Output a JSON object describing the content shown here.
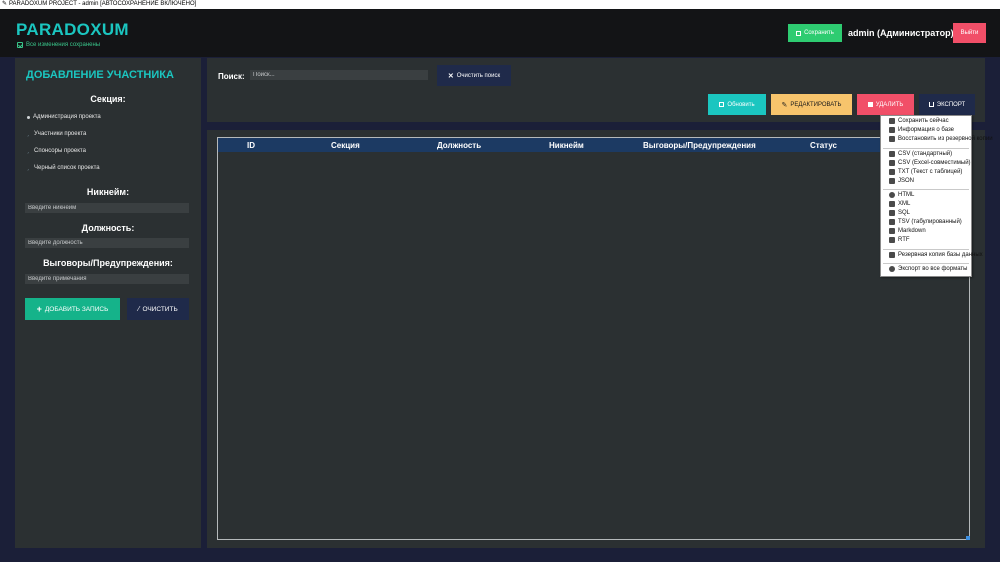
{
  "window": {
    "title": "PARADOXUM PROJECT - admin [АВТОСОХРАНЕНИЕ ВКЛЮЧЕНО]"
  },
  "header": {
    "brand": "PARADOXUM",
    "status": "Все изменения сохранены",
    "save_label": "Сохранить",
    "user": "admin (Администратор)",
    "logout_label": "Выйти"
  },
  "sidebar": {
    "title": "ДОБАВЛЕНИЕ УЧАСТНИКА",
    "section_label": "Секция:",
    "sections": [
      {
        "label": "Администрация проекта",
        "selected": true
      },
      {
        "label": "Участники проекта",
        "selected": false
      },
      {
        "label": "Спонсоры проекта",
        "selected": false
      },
      {
        "label": "Черный список проекта",
        "selected": false
      }
    ],
    "nickname_label": "Никнейм:",
    "nickname_placeholder": "Введите никнейм",
    "position_label": "Должность:",
    "position_placeholder": "Введите должность",
    "warnings_label": "Выговоры/Предупреждения:",
    "warnings_placeholder": "Введите примечания",
    "add_label": "ДОБАВИТЬ ЗАПИСЬ",
    "clear_label": "ОЧИСТИТЬ"
  },
  "toolbar": {
    "search_label": "Поиск:",
    "search_placeholder": "Поиск...",
    "clear_search_label": "Очистить поиск",
    "refresh_label": "Обновить",
    "edit_label": "РЕДАКТИРОВАТЬ",
    "delete_label": "УДАЛИТЬ",
    "export_label": "ЭКСПОРТ"
  },
  "table": {
    "columns": [
      "ID",
      "Секция",
      "Должность",
      "Никнейм",
      "Выговоры/Предупреждения",
      "Статус"
    ]
  },
  "export_menu": {
    "items": [
      {
        "label": "Сохранить сейчас",
        "icon": "save-icon"
      },
      {
        "label": "Информация о базе",
        "icon": "info-icon"
      },
      {
        "label": "Восстановить из резервной копии",
        "icon": "restore-icon"
      },
      {
        "label": "CSV (стандартный)",
        "icon": "file-icon"
      },
      {
        "label": "CSV (Excel-совместимый)",
        "icon": "file-icon"
      },
      {
        "label": "TXT (Текст с таблицей)",
        "icon": "file-icon"
      },
      {
        "label": "JSON",
        "icon": "file-icon"
      },
      {
        "label": "HTML",
        "icon": "globe-icon"
      },
      {
        "label": "XML",
        "icon": "file-icon"
      },
      {
        "label": "SQL",
        "icon": "database-icon"
      },
      {
        "label": "TSV (табулированный)",
        "icon": "file-icon"
      },
      {
        "label": "Markdown",
        "icon": "file-icon"
      },
      {
        "label": "RTF",
        "icon": "file-icon"
      },
      {
        "label": "Резервная копия базы данных",
        "icon": "backup-icon"
      },
      {
        "label": "Экспорт во все форматы",
        "icon": "export-all-icon"
      }
    ]
  },
  "colors": {
    "accent": "#1bc6c0",
    "success": "#2ecc71",
    "danger": "#f14f68",
    "warning": "#f7c46c",
    "navy": "#1f2a4a",
    "table_header": "#1c3a63"
  }
}
